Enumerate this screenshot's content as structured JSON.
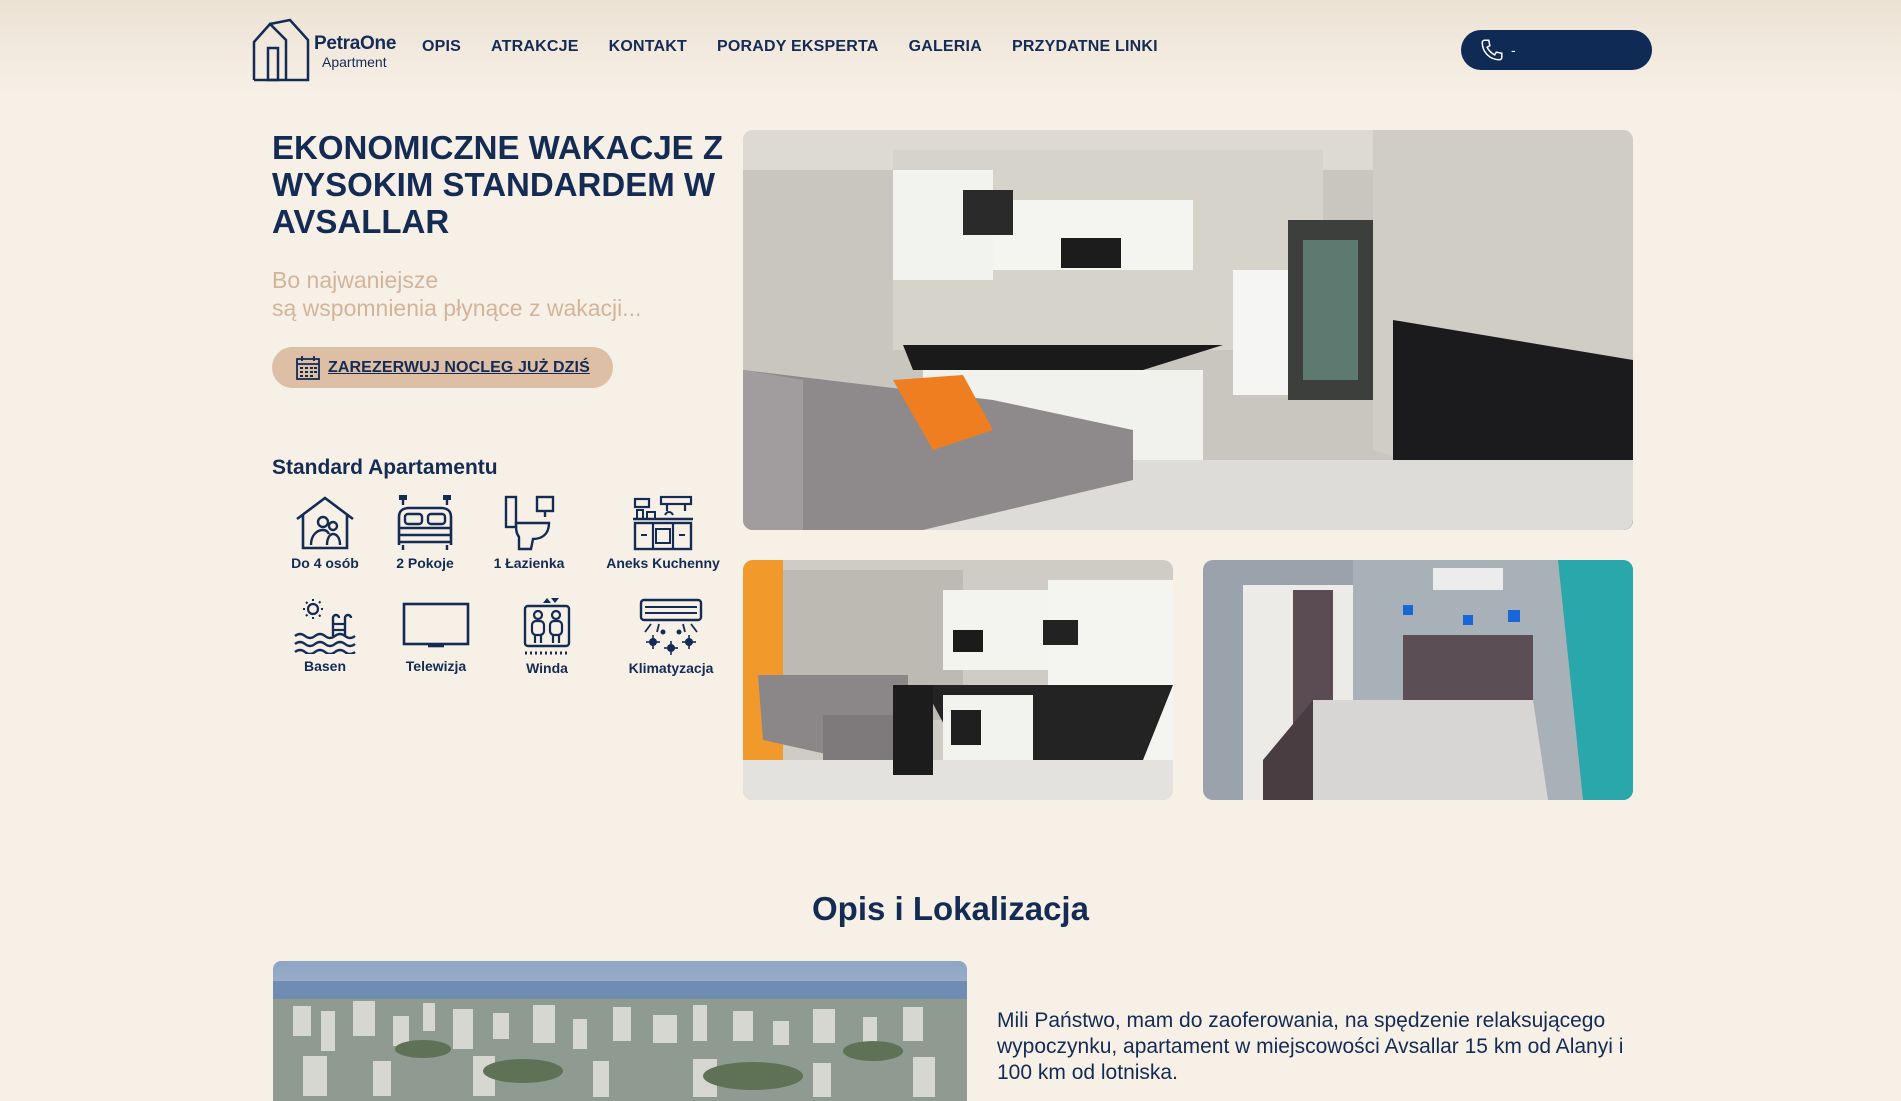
{
  "header": {
    "logo": {
      "name": "PetraOne",
      "sub": "Apartment",
      "icon": "house-outline-icon"
    },
    "nav": [
      "OPIS",
      "ATRAKCJE",
      "KONTAKT",
      "PORADY EKSPERTA",
      "GALERIA",
      "PRZYDATNE LINKI"
    ],
    "phone": {
      "icon": "phone-icon",
      "text": "-"
    }
  },
  "hero": {
    "title": "EKONOMICZNE WAKACJE Z WYSOKIM STANDARDEM W AVSALLAR",
    "subtitle_line1": "Bo najwaniejsze",
    "subtitle_line2": "są wspomnienia płynące z wakacji...",
    "reserve_button": {
      "icon": "calendar-icon",
      "label": "ZAREZERWUJ NOCLEG JUŻ DZIŚ"
    }
  },
  "standard": {
    "title": "Standard Apartamentu",
    "amenities": [
      {
        "icon": "people-house-icon",
        "label": "Do 4 osób"
      },
      {
        "icon": "bed-icon",
        "label": "2 Pokoje"
      },
      {
        "icon": "toilet-icon",
        "label": "1 Łazienka"
      },
      {
        "icon": "kitchen-icon",
        "label": "Aneks Kuchenny"
      },
      {
        "icon": "pool-icon",
        "label": "Basen"
      },
      {
        "icon": "tv-icon",
        "label": "Telewizja"
      },
      {
        "icon": "elevator-icon",
        "label": "Winda"
      },
      {
        "icon": "air-conditioner-icon",
        "label": "Klimatyzacja"
      }
    ]
  },
  "gallery": [
    "living-room-kitchen-photo",
    "kitchen-sofa-photo",
    "bedroom-photo"
  ],
  "description": {
    "title": "Opis i Lokalizacja",
    "photo": "avsallar-city-photo",
    "text": "Mili Państwo, mam do zaoferowania, na spędzenie relaksującego wypoczynku, apartament w miejscowości Avsallar 15 km od Alanyi i 100 km od lotniska."
  },
  "colors": {
    "navy": "#142b54",
    "background": "#f7f0e6",
    "accent": "#dcbfa4",
    "subtitle": "#d3b49a"
  }
}
